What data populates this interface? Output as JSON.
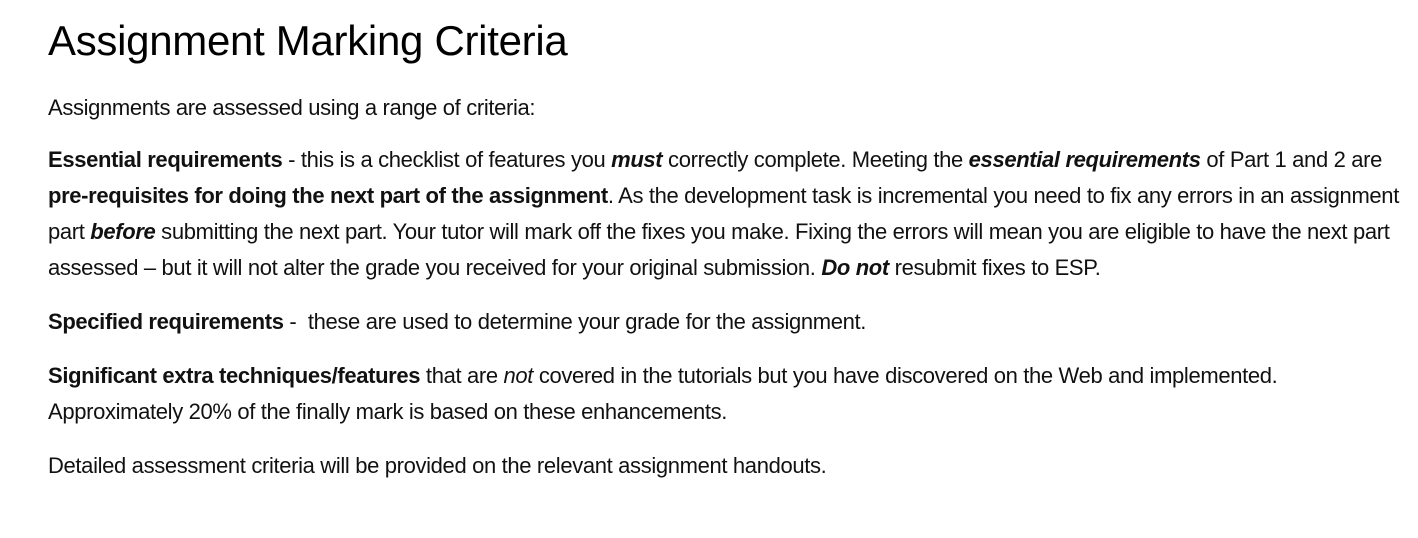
{
  "title": "Assignment Marking Criteria",
  "intro": "Assignments are assessed using a range of criteria:",
  "essential": {
    "label": "Essential requirements",
    "t1": " - this is a checklist of features you ",
    "must": "must",
    "t2": " correctly complete. Meeting the ",
    "essential_req": "essential requirements",
    "t3": " of Part 1 and 2 are ",
    "prereq": "pre-requisites for doing the next part of the assignment",
    "t4": ". As the development task is incremental you need to fix any errors in an assignment part ",
    "before": "before",
    "t5": " submitting the next part. Your tutor will mark off the fixes you make. Fixing the errors will mean you are eligible to have the next part assessed – but it will not alter the grade you received for your original submission. ",
    "do_not": "Do not",
    "t6": " resubmit fixes to ESP."
  },
  "specified": {
    "label": "Specified requirements",
    "text": " -  these are used to determine your grade for the assignment."
  },
  "significant": {
    "label": "Significant extra techniques/features",
    "t1": " that are ",
    "not": "not",
    "t2": " covered in the tutorials but you have discovered on the Web and implemented. Approximately 20% of the finally mark is based on these enhancements."
  },
  "closing": "Detailed assessment criteria will be provided on the relevant assignment handouts."
}
